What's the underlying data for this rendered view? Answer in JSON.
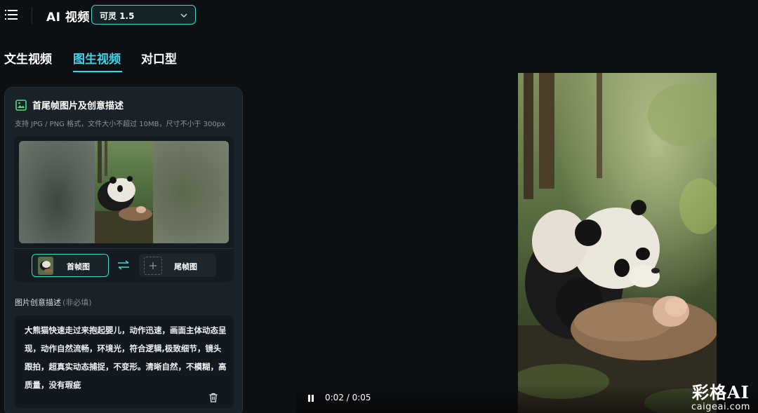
{
  "header": {
    "app_title": "AI 视频",
    "model_selected": "可灵 1.5",
    "menu_icon": "hamburger-icon"
  },
  "tabs": [
    {
      "label": "文生视频",
      "active": false
    },
    {
      "label": "图生视频",
      "active": true
    },
    {
      "label": "对口型",
      "active": false
    }
  ],
  "panel": {
    "title": "首尾帧图片及创意描述",
    "subtitle": "支持 JPG / PNG 格式，文件大小不超过 10MB，尺寸不小于 300px",
    "first_frame_label": "首帧图",
    "last_frame_label": "尾帧图",
    "desc_label": "图片创意描述",
    "desc_optional": "(非必填)",
    "desc_text": "大熊猫快速走过来抱起婴儿，动作迅速，画面主体动态呈现，动作自然流畅，环境光，符合逻辑,极致细节，镜头跟拍，超真实动态捕捉，不变形。清晰自然，不模糊，高质量，没有瑕疵"
  },
  "player": {
    "time": "0:02 / 0:05",
    "state": "playing"
  },
  "watermark": {
    "title": "彩格AI",
    "url": "caigeai.com"
  },
  "colors": {
    "accent": "#3fd6c8",
    "tab_active": "#3dd3e8",
    "background": "#0d1013",
    "panel": "#1a2229"
  }
}
